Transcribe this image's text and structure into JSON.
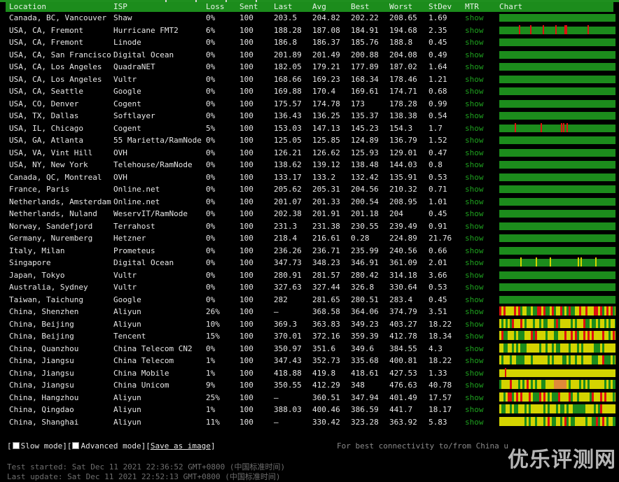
{
  "header": {
    "location": "Location",
    "isp": "ISP",
    "loss": "Loss",
    "sent": "Sent",
    "last": "Last",
    "avg": "Avg",
    "best": "Best",
    "worst": "Worst",
    "stdev": "StDev",
    "mtr": "MTR",
    "chart": "Chart"
  },
  "colors": {
    "header_bg": "#1c8c1c",
    "ok": "#1c8c1c",
    "warn": "#d4d400",
    "loss": "#e01010",
    "slow": "#e08a3a"
  },
  "rows": [
    {
      "location": "Canada, BC, Vancouver",
      "isp": "Shaw",
      "loss": "0%",
      "sent": "100",
      "last": "203.5",
      "avg": "204.82",
      "best": "202.22",
      "worst": "208.65",
      "stdev": "1.69",
      "mtr": "show",
      "chart": {
        "base": "g",
        "marks": []
      }
    },
    {
      "location": "USA, CA, Fremont",
      "isp": "Hurricane FMT2",
      "loss": "6%",
      "sent": "100",
      "last": "188.28",
      "avg": "187.08",
      "best": "184.91",
      "worst": "194.68",
      "stdev": "2.35",
      "mtr": "show",
      "chart": {
        "base": "g",
        "marks": [
          [
            28,
            "r"
          ],
          [
            44,
            "r"
          ],
          [
            62,
            "r"
          ],
          [
            80,
            "r"
          ],
          [
            93,
            "r"
          ],
          [
            95,
            "r"
          ],
          [
            126,
            "r"
          ]
        ]
      }
    },
    {
      "location": "USA, CA, Fremont",
      "isp": "Linode",
      "loss": "0%",
      "sent": "100",
      "last": "186.8",
      "avg": "186.37",
      "best": "185.76",
      "worst": "188.8",
      "stdev": "0.45",
      "mtr": "show",
      "chart": {
        "base": "g",
        "marks": []
      }
    },
    {
      "location": "USA, CA, San Francisco",
      "isp": "Digital Ocean",
      "loss": "0%",
      "sent": "100",
      "last": "201.89",
      "avg": "201.49",
      "best": "200.88",
      "worst": "204.08",
      "stdev": "0.49",
      "mtr": "show",
      "chart": {
        "base": "g",
        "marks": []
      }
    },
    {
      "location": "USA, CA, Los Angeles",
      "isp": "QuadraNET",
      "loss": "0%",
      "sent": "100",
      "last": "182.05",
      "avg": "179.21",
      "best": "177.89",
      "worst": "187.02",
      "stdev": "1.64",
      "mtr": "show",
      "chart": {
        "base": "g",
        "marks": []
      }
    },
    {
      "location": "USA, CA, Los Angeles",
      "isp": "Vultr",
      "loss": "0%",
      "sent": "100",
      "last": "168.66",
      "avg": "169.23",
      "best": "168.34",
      "worst": "178.46",
      "stdev": "1.21",
      "mtr": "show",
      "chart": {
        "base": "g",
        "marks": []
      }
    },
    {
      "location": "USA, CA, Seattle",
      "isp": "Google",
      "loss": "0%",
      "sent": "100",
      "last": "169.88",
      "avg": "170.4",
      "best": "169.61",
      "worst": "174.71",
      "stdev": "0.68",
      "mtr": "show",
      "chart": {
        "base": "g",
        "marks": []
      }
    },
    {
      "location": "USA, CO, Denver",
      "isp": "Cogent",
      "loss": "0%",
      "sent": "100",
      "last": "175.57",
      "avg": "174.78",
      "best": "173",
      "worst": "178.28",
      "stdev": "0.99",
      "mtr": "show",
      "chart": {
        "base": "g",
        "marks": []
      }
    },
    {
      "location": "USA, TX, Dallas",
      "isp": "Softlayer",
      "loss": "0%",
      "sent": "100",
      "last": "136.43",
      "avg": "136.25",
      "best": "135.37",
      "worst": "138.38",
      "stdev": "0.54",
      "mtr": "show",
      "chart": {
        "base": "g",
        "marks": []
      }
    },
    {
      "location": "USA, IL, Chicago",
      "isp": "Cogent",
      "loss": "5%",
      "sent": "100",
      "last": "153.03",
      "avg": "147.13",
      "best": "145.23",
      "worst": "154.3",
      "stdev": "1.7",
      "mtr": "show",
      "chart": {
        "base": "g",
        "marks": [
          [
            22,
            "r"
          ],
          [
            59,
            "r"
          ],
          [
            88,
            "r"
          ],
          [
            91,
            "r"
          ],
          [
            96,
            "r"
          ]
        ]
      }
    },
    {
      "location": "USA, GA, Atlanta",
      "isp": "55 Marietta/RamNode",
      "loss": "0%",
      "sent": "100",
      "last": "125.05",
      "avg": "125.85",
      "best": "124.89",
      "worst": "136.79",
      "stdev": "1.52",
      "mtr": "show",
      "chart": {
        "base": "g",
        "marks": []
      }
    },
    {
      "location": "USA, VA, Vint Hill",
      "isp": "OVH",
      "loss": "0%",
      "sent": "100",
      "last": "126.21",
      "avg": "126.62",
      "best": "125.93",
      "worst": "129.01",
      "stdev": "0.47",
      "mtr": "show",
      "chart": {
        "base": "g",
        "marks": []
      }
    },
    {
      "location": "USA, NY, New York",
      "isp": "Telehouse/RamNode",
      "loss": "0%",
      "sent": "100",
      "last": "138.62",
      "avg": "139.12",
      "best": "138.48",
      "worst": "144.03",
      "stdev": "0.8",
      "mtr": "show",
      "chart": {
        "base": "g",
        "marks": []
      }
    },
    {
      "location": "Canada, QC, Montreal",
      "isp": "OVH",
      "loss": "0%",
      "sent": "100",
      "last": "133.17",
      "avg": "133.2",
      "best": "132.42",
      "worst": "135.91",
      "stdev": "0.53",
      "mtr": "show",
      "chart": {
        "base": "g",
        "marks": []
      }
    },
    {
      "location": "France, Paris",
      "isp": "Online.net",
      "loss": "0%",
      "sent": "100",
      "last": "205.62",
      "avg": "205.31",
      "best": "204.56",
      "worst": "210.32",
      "stdev": "0.71",
      "mtr": "show",
      "chart": {
        "base": "g",
        "marks": []
      }
    },
    {
      "location": "Netherlands, Amsterdam",
      "isp": "Online.net",
      "loss": "0%",
      "sent": "100",
      "last": "201.07",
      "avg": "201.33",
      "best": "200.54",
      "worst": "208.95",
      "stdev": "1.01",
      "mtr": "show",
      "chart": {
        "base": "g",
        "marks": []
      }
    },
    {
      "location": "Netherlands, Nuland",
      "isp": "WeservIT/RamNode",
      "loss": "0%",
      "sent": "100",
      "last": "202.38",
      "avg": "201.91",
      "best": "201.18",
      "worst": "204",
      "stdev": "0.45",
      "mtr": "show",
      "chart": {
        "base": "g",
        "marks": []
      }
    },
    {
      "location": "Norway, Sandefjord",
      "isp": "Terrahost",
      "loss": "0%",
      "sent": "100",
      "last": "231.3",
      "avg": "231.38",
      "best": "230.55",
      "worst": "239.49",
      "stdev": "0.91",
      "mtr": "show",
      "chart": {
        "base": "g",
        "marks": []
      }
    },
    {
      "location": "Germany, Nuremberg",
      "isp": "Hetzner",
      "loss": "0%",
      "sent": "100",
      "last": "218.4",
      "avg": "216.61",
      "best": "0.28",
      "worst": "224.89",
      "stdev": "21.76",
      "mtr": "show",
      "chart": {
        "base": "g",
        "marks": []
      }
    },
    {
      "location": "Italy, Milan",
      "isp": "Prometeus",
      "loss": "0%",
      "sent": "100",
      "last": "236.26",
      "avg": "236.71",
      "best": "235.99",
      "worst": "240.56",
      "stdev": "0.66",
      "mtr": "show",
      "chart": {
        "base": "g",
        "marks": []
      }
    },
    {
      "location": "Singapore",
      "isp": "Digital Ocean",
      "loss": "0%",
      "sent": "100",
      "last": "347.73",
      "avg": "348.23",
      "best": "346.91",
      "worst": "361.09",
      "stdev": "2.01",
      "mtr": "show",
      "chart": {
        "base": "g",
        "marks": [
          [
            30,
            "y"
          ],
          [
            52,
            "y"
          ],
          [
            72,
            "y"
          ],
          [
            112,
            "y"
          ],
          [
            116,
            "y"
          ],
          [
            137,
            "y"
          ]
        ]
      }
    },
    {
      "location": "Japan, Tokyo",
      "isp": "Vultr",
      "loss": "0%",
      "sent": "100",
      "last": "280.91",
      "avg": "281.57",
      "best": "280.42",
      "worst": "314.18",
      "stdev": "3.66",
      "mtr": "show",
      "chart": {
        "base": "g",
        "marks": []
      }
    },
    {
      "location": "Australia, Sydney",
      "isp": "Vultr",
      "loss": "0%",
      "sent": "100",
      "last": "327.63",
      "avg": "327.44",
      "best": "326.8",
      "worst": "330.64",
      "stdev": "0.53",
      "mtr": "show",
      "chart": {
        "base": "g",
        "marks": []
      }
    },
    {
      "location": "Taiwan, Taichung",
      "isp": "Google",
      "loss": "0%",
      "sent": "100",
      "last": "282",
      "avg": "281.65",
      "best": "280.51",
      "worst": "283.4",
      "stdev": "0.45",
      "mtr": "show",
      "chart": {
        "base": "g",
        "marks": []
      }
    },
    {
      "location": "China, Shenzhen",
      "isp": "Aliyun",
      "loss": "26%",
      "sent": "100",
      "last": "–",
      "avg": "368.58",
      "best": "364.06",
      "worst": "374.79",
      "stdev": "3.51",
      "mtr": "show",
      "chart": {
        "base": "mix",
        "seed": 3,
        "loss": 0.26
      }
    },
    {
      "location": "China, Beijing",
      "isp": "Aliyun",
      "loss": "10%",
      "sent": "100",
      "last": "369.3",
      "avg": "363.83",
      "best": "349.23",
      "worst": "403.27",
      "stdev": "18.22",
      "mtr": "show",
      "chart": {
        "base": "mix",
        "seed": 7,
        "loss": 0.1
      }
    },
    {
      "location": "China, Beijing",
      "isp": "Tencent",
      "loss": "15%",
      "sent": "100",
      "last": "370.01",
      "avg": "372.16",
      "best": "359.39",
      "worst": "412.78",
      "stdev": "18.34",
      "mtr": "show",
      "chart": {
        "base": "mix",
        "seed": 11,
        "loss": 0.15
      }
    },
    {
      "location": "China, Quanzhou",
      "isp": "China Telecom CN2",
      "loss": "0%",
      "sent": "100",
      "last": "350.97",
      "avg": "351.6",
      "best": "349.6",
      "worst": "384.55",
      "stdev": "4.3",
      "mtr": "show",
      "chart": {
        "base": "mix",
        "seed": 13,
        "loss": 0.0
      }
    },
    {
      "location": "China, Jiangsu",
      "isp": "China Telecom",
      "loss": "1%",
      "sent": "100",
      "last": "347.43",
      "avg": "352.73",
      "best": "335.68",
      "worst": "400.81",
      "stdev": "18.22",
      "mtr": "show",
      "chart": {
        "base": "mix",
        "seed": 17,
        "loss": 0.01
      }
    },
    {
      "location": "China, Jiangsu",
      "isp": "China Mobile",
      "loss": "1%",
      "sent": "100",
      "last": "418.88",
      "avg": "419.8",
      "best": "418.61",
      "worst": "427.53",
      "stdev": "1.33",
      "mtr": "show",
      "chart": {
        "base": "y",
        "marks": [
          [
            8,
            "r"
          ]
        ]
      }
    },
    {
      "location": "China, Jiangsu",
      "isp": "China Unicom",
      "loss": "9%",
      "sent": "100",
      "last": "350.55",
      "avg": "412.29",
      "best": "348",
      "worst": "476.63",
      "stdev": "40.78",
      "mtr": "show",
      "chart": {
        "base": "mix",
        "seed": 23,
        "loss": 0.09,
        "slow": true
      }
    },
    {
      "location": "China, Hangzhou",
      "isp": "Aliyun",
      "loss": "25%",
      "sent": "100",
      "last": "–",
      "avg": "360.51",
      "best": "347.94",
      "worst": "401.49",
      "stdev": "17.57",
      "mtr": "show",
      "chart": {
        "base": "mix",
        "seed": 29,
        "loss": 0.25
      }
    },
    {
      "location": "China, Qingdao",
      "isp": "Aliyun",
      "loss": "1%",
      "sent": "100",
      "last": "388.03",
      "avg": "400.46",
      "best": "386.59",
      "worst": "441.7",
      "stdev": "18.17",
      "mtr": "show",
      "chart": {
        "base": "mix",
        "seed": 31,
        "loss": 0.01
      }
    },
    {
      "location": "China, Shanghai",
      "isp": "Aliyun",
      "loss": "11%",
      "sent": "100",
      "last": "–",
      "avg": "330.42",
      "best": "323.28",
      "worst": "363.92",
      "stdev": "5.83",
      "mtr": "show",
      "chart": {
        "base": "mix",
        "seed": 37,
        "loss": 0.11
      }
    }
  ],
  "footer": {
    "slow_mode": "Slow mode",
    "advanced_mode": "Advanced mode",
    "save_image": "Save as image",
    "best_connectivity": "For best connectivity to/from China u",
    "test_started": "Test started: Sat Dec 11 2021 22:36:52 GMT+0800 (中国标准时间)",
    "last_update": "Last update:  Sat Dec 11 2021 22:52:13 GMT+0800 (中国标准时间)",
    "watermark": "优乐评测网"
  }
}
